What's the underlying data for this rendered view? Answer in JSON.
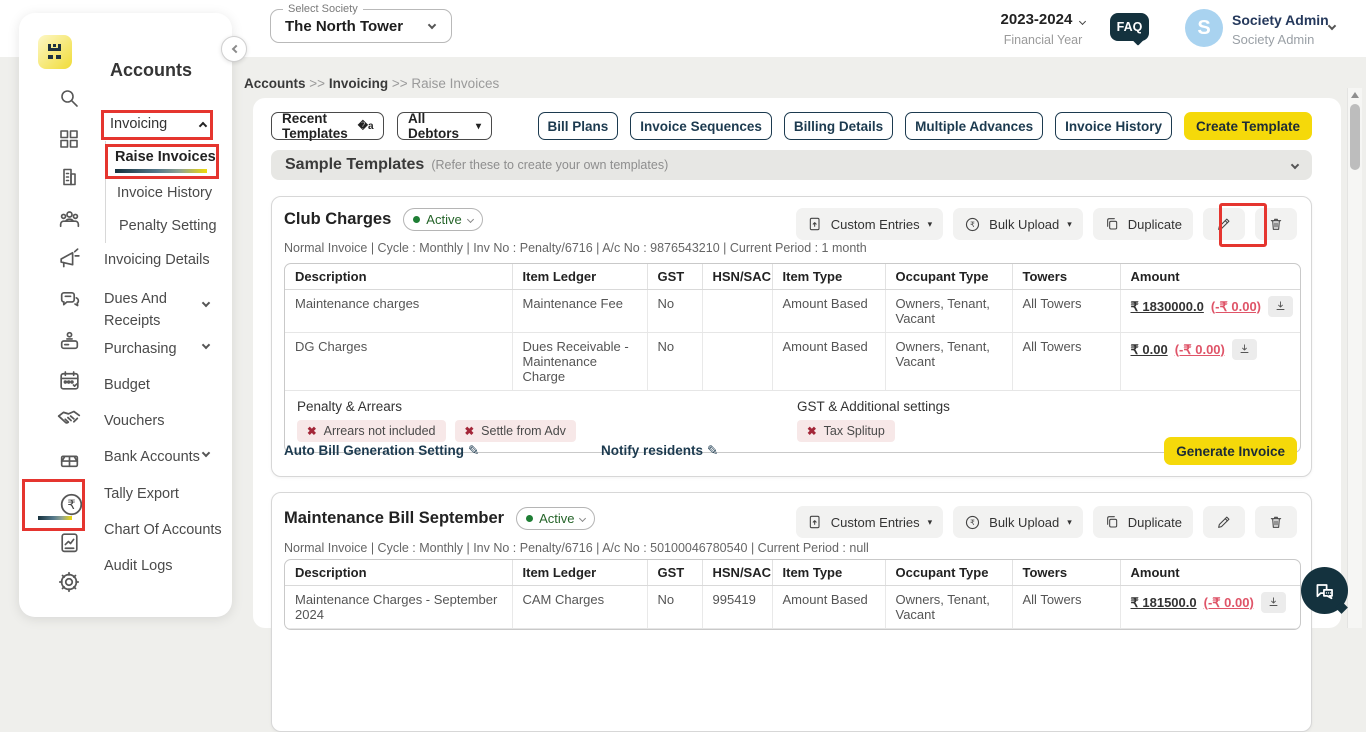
{
  "colors": {
    "accent_yellow": "#F5D90A",
    "navy": "#1C3A4F",
    "annotation_red": "#E5352F",
    "negative_red": "#DF5468",
    "dark_teal": "#14323E",
    "avatar_blue": "#A9D3F0",
    "active_green": "#1E7E34"
  },
  "header": {
    "select_society_label": "Select Society",
    "society_name": "The North Tower",
    "financial_year_value": "2023-2024",
    "financial_year_label": "Financial Year",
    "faq": "FAQ",
    "user_name": "Society Admin",
    "user_role": "Society Admin",
    "avatar_initial": "S"
  },
  "sidebar": {
    "module_title": "Accounts",
    "icons": [
      "logo",
      "search",
      "dashboard-grid",
      "building",
      "residents-group",
      "megaphone",
      "chat-messages",
      "front-desk",
      "calendar",
      "handshake",
      "bank-box",
      "rupee-accounts",
      "report-document",
      "settings-gear"
    ],
    "menu": {
      "invoicing": "Invoicing",
      "raise_invoices": "Raise Invoices",
      "invoice_history": "Invoice History",
      "penalty_setting": "Penalty Setting",
      "invoicing_details": "Invoicing Details",
      "dues_and_receipts": "Dues And Receipts",
      "purchasing": "Purchasing",
      "budget": "Budget",
      "vouchers": "Vouchers",
      "bank_accounts": "Bank Accounts",
      "tally_export": "Tally Export",
      "chart_of_accounts": "Chart Of Accounts",
      "audit_logs": "Audit Logs"
    }
  },
  "breadcrumb": {
    "l1": "Accounts",
    "sep1": ">>",
    "l2": "Invoicing",
    "sep2": ">>",
    "l3": "Raise Invoices"
  },
  "filters": {
    "templates": "Recent Templates",
    "debtors": "All Debtors"
  },
  "toolbar": {
    "bill_plans": "Bill Plans",
    "invoice_sequences": "Invoice Sequences",
    "billing_details": "Billing Details",
    "multiple_advances": "Multiple Advances",
    "invoice_history": "Invoice History",
    "create_template": "Create Template"
  },
  "sample_templates": {
    "title": "Sample Templates",
    "hint": "(Refer these to create your own templates)"
  },
  "table_headers": [
    "Description",
    "Item Ledger",
    "GST",
    "HSN/SAC",
    "Item Type",
    "Occupant Type",
    "Towers",
    "Amount"
  ],
  "card_actions": {
    "custom_entries": "Custom Entries",
    "bulk_upload": "Bulk Upload",
    "duplicate": "Duplicate"
  },
  "cards": [
    {
      "title": "Club Charges",
      "status": "Active",
      "meta": "Normal Invoice | Cycle : Monthly | Inv No : Penalty/6716 | A/c No : 9876543210 | Current Period : 1 month",
      "rows": [
        {
          "description": "Maintenance charges",
          "item_ledger": "Maintenance Fee",
          "gst": "No",
          "hsn_sac": "",
          "item_type": "Amount Based",
          "occupant_type": "Owners, Tenant, Vacant",
          "towers": "All Towers",
          "amount": "₹ 1830000.0",
          "adjustment": "(-₹ 0.00)"
        },
        {
          "description": "DG Charges",
          "item_ledger": "Dues Receivable - Maintenance Charge",
          "gst": "No",
          "hsn_sac": "",
          "item_type": "Amount Based",
          "occupant_type": "Owners, Tenant, Vacant",
          "towers": "All Towers",
          "amount": "₹ 0.00",
          "adjustment": "(-₹ 0.00)"
        }
      ],
      "penalty": {
        "title": "Penalty & Arrears",
        "chip1": "Arrears not included",
        "chip2": "Settle from Adv"
      },
      "gst_settings": {
        "title": "GST & Additional settings",
        "chip1": "Tax Splitup"
      },
      "footer": {
        "auto_bill": "Auto Bill Generation Setting",
        "notify": "Notify residents",
        "generate": "Generate Invoice"
      }
    },
    {
      "title": "Maintenance Bill September",
      "status": "Active",
      "meta": "Normal Invoice | Cycle : Monthly | Inv No : Penalty/6716 | A/c No : 50100046780540 | Current Period : null",
      "rows": [
        {
          "description": "Maintenance Charges - September 2024",
          "item_ledger": "CAM Charges",
          "gst": "No",
          "hsn_sac": "995419",
          "item_type": "Amount Based",
          "occupant_type": "Owners, Tenant, Vacant",
          "towers": "All Towers",
          "amount": "₹ 181500.0",
          "adjustment": "(-₹ 0.00)"
        }
      ]
    }
  ]
}
